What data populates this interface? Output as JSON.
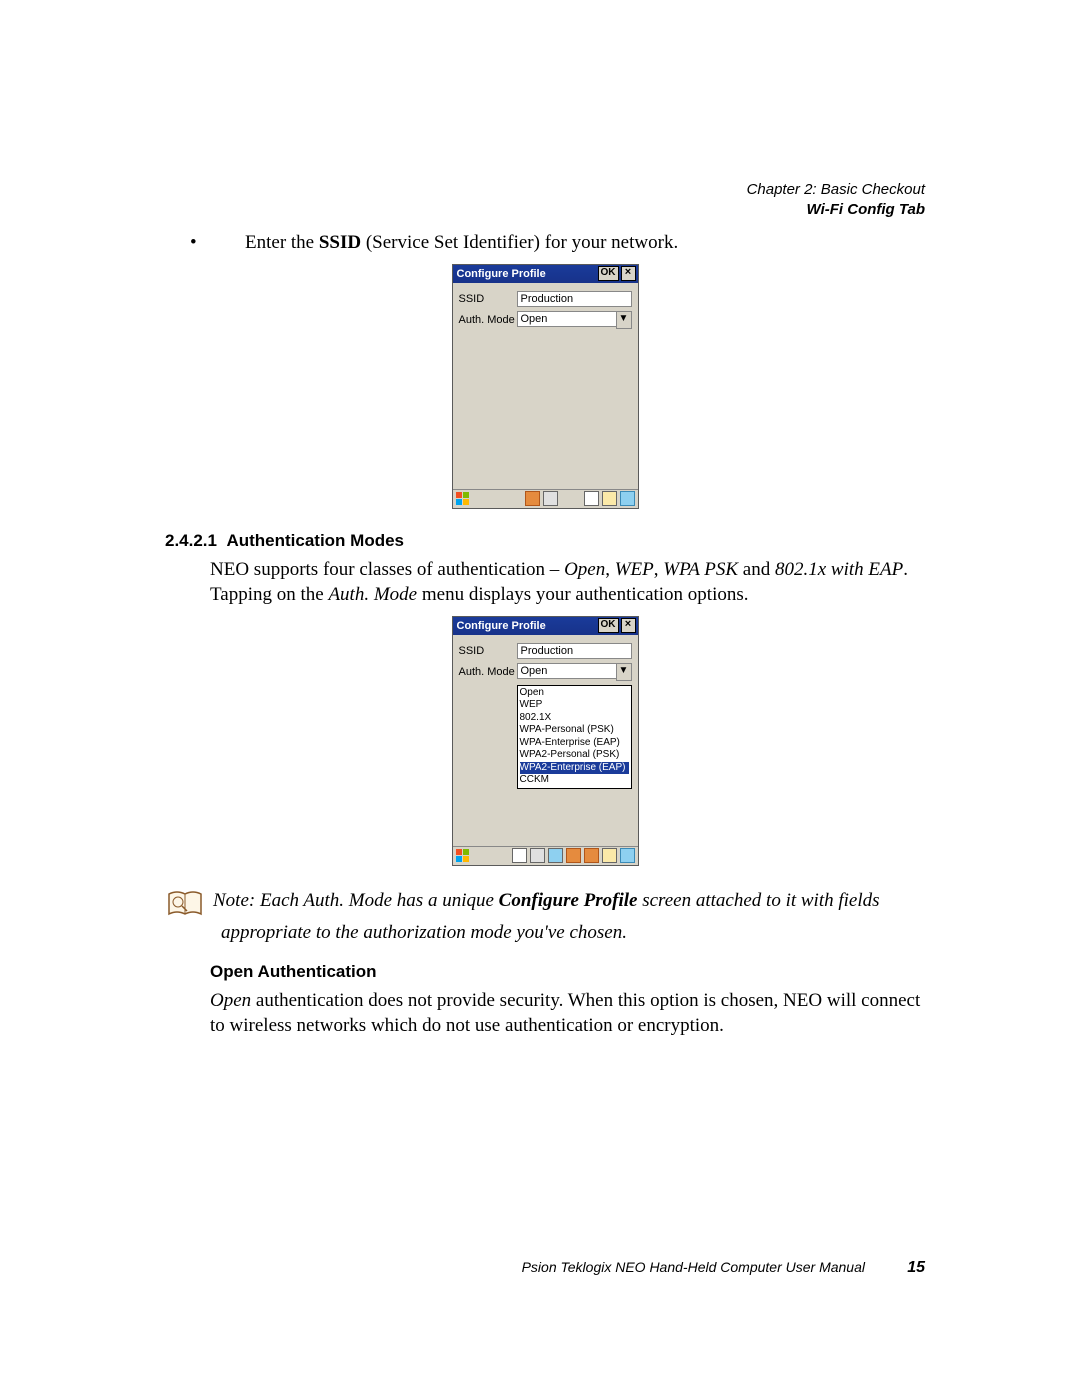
{
  "header": {
    "line1": "Chapter 2: Basic Checkout",
    "line2": "Wi-Fi Config Tab"
  },
  "bullet": {
    "pre": "Enter the ",
    "b": "SSID",
    "post": " (Service Set Identifier) for your network."
  },
  "win1": {
    "title": "Configure Profile",
    "ok": "OK",
    "close": "×",
    "ssid_lbl": "SSID",
    "ssid_val": "Production",
    "auth_lbl": "Auth. Mode",
    "auth_val": "Open"
  },
  "section": {
    "num": "2.4.2.1",
    "title": "Authentication Modes"
  },
  "para1": {
    "a": "NEO supports four classes of authentication – ",
    "o": "Open",
    "s1": ", ",
    "w": "WEP",
    "s2": ", ",
    "p": "WPA PSK",
    "s3": " and ",
    "e": "802.1x with EAP",
    "d": ". Tapping on the ",
    "am": "Auth. Mode",
    "end": " menu displays your authentication options."
  },
  "win2": {
    "title": "Configure Profile",
    "ok": "OK",
    "close": "×",
    "ssid_lbl": "SSID",
    "ssid_val": "Production",
    "auth_lbl": "Auth. Mode",
    "auth_val": "Open",
    "opts": {
      "o0": "Open",
      "o1": "WEP",
      "o2": "802.1X",
      "o3": "WPA-Personal (PSK)",
      "o4": "WPA-Enterprise (EAP)",
      "o5": "WPA2-Personal (PSK)",
      "o6": "WPA2-Enterprise (EAP)",
      "o7": "CCKM"
    }
  },
  "note": {
    "pre": "Note: Each Auth. Mode has a unique ",
    "b": "Configure Profile",
    "post": " screen attached to it with fields",
    "line2": "appropriate to the authorization mode you've chosen."
  },
  "sub": {
    "title": "Open Authentication"
  },
  "para2": {
    "i": "Open",
    "rest": " authentication does not provide security. When this option is chosen, NEO will connect to wireless networks which do not use authentication or encryption."
  },
  "footer": {
    "text": "Psion Teklogix NEO Hand-Held Computer User Manual",
    "page": "15"
  }
}
